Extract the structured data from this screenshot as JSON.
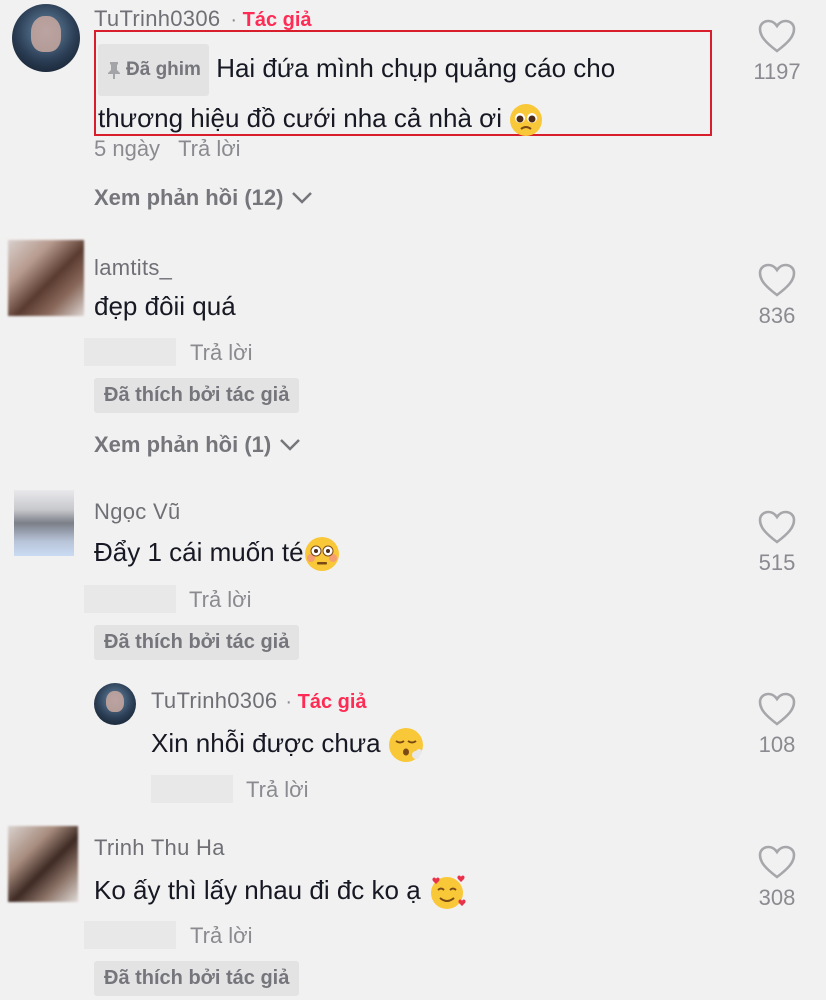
{
  "comments": [
    {
      "username": "TuTrinh0306",
      "author_label": "Tác giả",
      "pinned_label": "Đã ghim",
      "text_line1": "Hai đứa mình chụp quảng cáo cho",
      "text_line2": "thương hiệu đồ cưới nha cả nhà ơi",
      "emoji": "pleading-face",
      "time": "5 ngày",
      "reply_label": "Trả lời",
      "view_replies": "Xem phản hồi (12)",
      "likes": "1197"
    },
    {
      "username": "lamtits_",
      "text": "đẹp đôii quá",
      "reply_label": "Trả lời",
      "liked_by_author": "Đã thích bởi tác giả",
      "view_replies": "Xem phản hồi (1)",
      "likes": "836"
    },
    {
      "username": "Ngọc Vũ",
      "text": "Đẩy 1 cái muốn té",
      "emoji": "flushed-face",
      "reply_label": "Trả lời",
      "liked_by_author": "Đã thích bởi tác giả",
      "likes": "515"
    },
    {
      "username": "TuTrinh0306",
      "author_label": "Tác giả",
      "text": "Xin nhỗi được chưa",
      "emoji": "face-exhaling",
      "reply_label": "Trả lời",
      "likes": "108"
    },
    {
      "username": "Trinh Thu Ha",
      "text": "Ko ấy thì lấy nhau đi đc ko ạ",
      "emoji": "smiling-face-with-hearts",
      "reply_label": "Trả lời",
      "liked_by_author": "Đã thích bởi tác giả",
      "likes": "308"
    }
  ],
  "colors": {
    "background": "#f2f1f1",
    "author_accent": "#fe2c55",
    "highlight_border": "#d81e2c",
    "muted_text": "#8a8b91"
  }
}
